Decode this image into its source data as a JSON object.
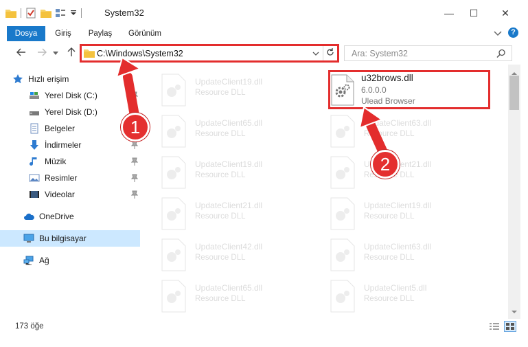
{
  "window": {
    "title": "System32",
    "minimize": "—",
    "maximize": "☐",
    "close": "✕"
  },
  "ribbon": {
    "tabs": [
      "Dosya",
      "Giriş",
      "Paylaş",
      "Görünüm"
    ],
    "help": "?"
  },
  "navigation": {
    "address": "C:\\Windows\\System32",
    "search_placeholder": "Ara: System32"
  },
  "sidebar": {
    "quick_access": "Hızlı erişim",
    "items": [
      {
        "label": "Yerel Disk (C:)",
        "icon": "drive-icon"
      },
      {
        "label": "Yerel Disk (D:)",
        "icon": "drive-icon"
      },
      {
        "label": "Belgeler",
        "icon": "documents-icon"
      },
      {
        "label": "İndirmeler",
        "icon": "downloads-icon"
      },
      {
        "label": "Müzik",
        "icon": "music-icon"
      },
      {
        "label": "Resimler",
        "icon": "pictures-icon"
      },
      {
        "label": "Videolar",
        "icon": "videos-icon"
      }
    ],
    "onedrive": "OneDrive",
    "this_pc": "Bu bilgisayar",
    "network": "Ağ"
  },
  "files": {
    "left_column": [
      {
        "name": "UpdateClient19.dll",
        "type": "Resource DLL"
      },
      {
        "name": "UpdateClient65.dll",
        "type": "Resource DLL"
      },
      {
        "name": "UpdateClient19.dll",
        "type": "Resource DLL"
      },
      {
        "name": "UpdateClient21.dll",
        "type": "Resource DLL"
      },
      {
        "name": "UpdateClient42.dll",
        "type": "Resource DLL"
      },
      {
        "name": "UpdateClient65.dll",
        "type": "Resource DLL"
      }
    ],
    "right_column": [
      {
        "name": "UpdateClient63.dll",
        "type": "Resource DLL"
      },
      {
        "name": "UpdateClient21.dll",
        "type": "Resource DLL"
      },
      {
        "name": "UpdateClient19.dll",
        "type": "Resource DLL"
      },
      {
        "name": "UpdateClient63.dll",
        "type": "Resource DLL"
      },
      {
        "name": "UpdateClient5.dll",
        "type": "Resource DLL"
      }
    ],
    "highlighted": {
      "name": "u32brows.dll",
      "version": "6.0.0.0",
      "description": "Ulead Browser"
    }
  },
  "status": {
    "item_count": "173 öğe"
  },
  "annotations": {
    "step1": "1",
    "step2": "2",
    "color": "#e32d2d"
  }
}
